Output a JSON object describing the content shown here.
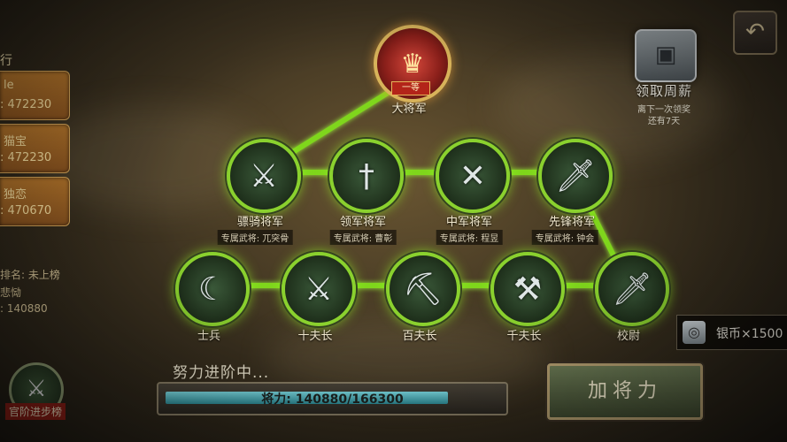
{
  "left_panel": {
    "heading": "行",
    "cards": [
      {
        "name": "le",
        "score": ": 472230"
      },
      {
        "name": "猫宝",
        "score": ": 472230"
      },
      {
        "name": "独恋",
        "score": ": 470670"
      }
    ],
    "rank_label": "排名: 未上榜",
    "player_name": "悲恸",
    "player_power": ": 140880"
  },
  "top_rank": {
    "name": "大将军",
    "badge": "一等",
    "glyph": "♛"
  },
  "general_ranks": [
    {
      "name": "骠骑将军",
      "exclusive": "专属武将: 兀突骨",
      "glyph": "⚔"
    },
    {
      "name": "领军将军",
      "exclusive": "专属武将: 曹彰",
      "glyph": "†"
    },
    {
      "name": "中军将军",
      "exclusive": "专属武将: 程昱",
      "glyph": "✕"
    },
    {
      "name": "先锋将军",
      "exclusive": "专属武将: 钟会",
      "glyph": "🗡"
    }
  ],
  "soldier_ranks": [
    {
      "name": "士兵",
      "glyph": "☾"
    },
    {
      "name": "十夫长",
      "glyph": "⚔"
    },
    {
      "name": "百夫长",
      "glyph": "⛏"
    },
    {
      "name": "千夫长",
      "glyph": "⚒"
    },
    {
      "name": "校尉",
      "glyph": "🗡"
    }
  ],
  "weekly_reward": {
    "label": "领取周薪",
    "note_line1": "离下一次领奖",
    "note_line2": "还有7天",
    "icon": "chest-icon"
  },
  "currency": {
    "label": "银币×1500",
    "icon": "silver-coin-icon"
  },
  "progress": {
    "status": "努力进阶中...",
    "text": "将力: 140880/166300",
    "fraction": 0.847
  },
  "buttons": {
    "add_power": "加将力",
    "back_glyph": "↶"
  },
  "promotion": {
    "label": "官阶进步榜",
    "glyph": "⚔"
  },
  "colors": {
    "active_line": "#7fd61c",
    "accent_gold": "#d8b35a"
  }
}
